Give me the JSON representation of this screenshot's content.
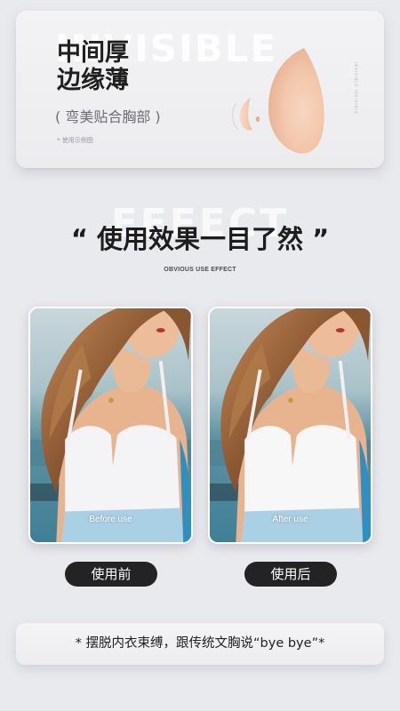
{
  "top_card": {
    "watermark": "INVISIBLE",
    "title_line1": "中间厚",
    "title_line2": "边缘薄",
    "subtitle": "( 弯美贴合胸部 )",
    "note": "* 使用示例图",
    "vertical_note": "INVISIBLE INVISIBLE"
  },
  "effect": {
    "watermark": "EFFECT",
    "title": "“ 使用效果一目了然 ”",
    "subtitle": "OBVIOUS USE EFFECT"
  },
  "photos": {
    "before_caption": "Before use",
    "after_caption": "After use"
  },
  "buttons": {
    "before_label": "使用前",
    "after_label": "使用后"
  },
  "banner": {
    "text": "* 摆脱内衣束缚，跟传统文胸说“bye bye”*"
  },
  "colors": {
    "background": "#e9eaee",
    "pill": "#232325",
    "skin": "#f2c6a8"
  },
  "icons": [
    "bra-pad-graphic"
  ]
}
